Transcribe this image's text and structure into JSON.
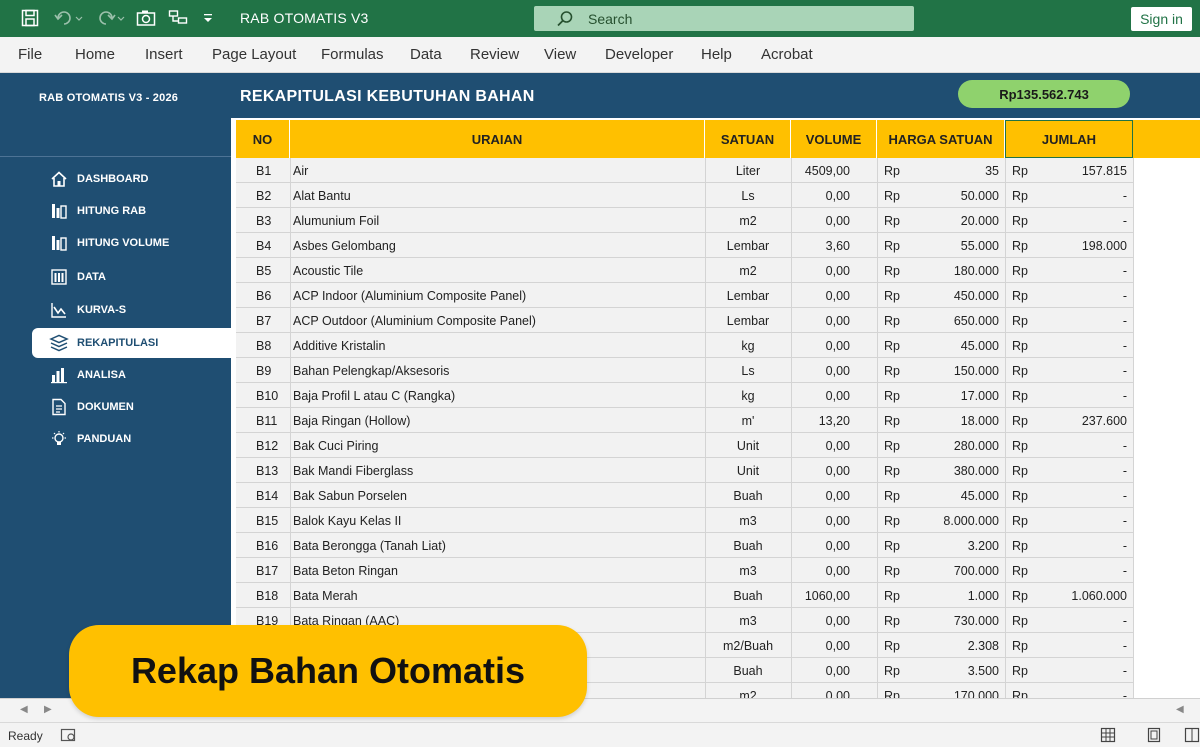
{
  "titlebar": {
    "app_title": "RAB OTOMATIS V3",
    "search_placeholder": "Search",
    "signin_label": "Sign in"
  },
  "ribbon": {
    "tabs": [
      "File",
      "Home",
      "Insert",
      "Page Layout",
      "Formulas",
      "Data",
      "Review",
      "View",
      "Developer",
      "Help",
      "Acrobat"
    ]
  },
  "sidebar": {
    "title": "RAB OTOMATIS V3 - 2026",
    "items": [
      {
        "label": "DASHBOARD",
        "icon": "home-icon",
        "active": false
      },
      {
        "label": "HITUNG RAB",
        "icon": "calculator-icon",
        "active": false
      },
      {
        "label": "HITUNG VOLUME",
        "icon": "calculator-icon",
        "active": false
      },
      {
        "label": "DATA",
        "icon": "database-icon",
        "active": false
      },
      {
        "label": "KURVA-S",
        "icon": "line-chart-icon",
        "active": false
      },
      {
        "label": "REKAPITULASI",
        "icon": "layers-icon",
        "active": true
      },
      {
        "label": "ANALISA",
        "icon": "bar-chart-icon",
        "active": false
      },
      {
        "label": "DOKUMEN",
        "icon": "document-icon",
        "active": false
      },
      {
        "label": "PANDUAN",
        "icon": "lightbulb-icon",
        "active": false
      }
    ]
  },
  "main": {
    "title": "REKAPITULASI KEBUTUHAN BAHAN",
    "total": "Rp135.562.743"
  },
  "table": {
    "columns": [
      "NO",
      "URAIAN",
      "SATUAN",
      "VOLUME",
      "HARGA SATUAN",
      "JUMLAH"
    ],
    "currency": "Rp",
    "rows": [
      {
        "no": "B1",
        "uraian": "Air",
        "satuan": "Liter",
        "volume": "4509,00",
        "harga": "35",
        "jumlah": "157.815"
      },
      {
        "no": "B2",
        "uraian": "Alat Bantu",
        "satuan": "Ls",
        "volume": "0,00",
        "harga": "50.000",
        "jumlah": "-"
      },
      {
        "no": "B3",
        "uraian": "Alumunium Foil",
        "satuan": "m2",
        "volume": "0,00",
        "harga": "20.000",
        "jumlah": "-"
      },
      {
        "no": "B4",
        "uraian": "Asbes Gelombang",
        "satuan": "Lembar",
        "volume": "3,60",
        "harga": "55.000",
        "jumlah": "198.000"
      },
      {
        "no": "B5",
        "uraian": "Acoustic Tile",
        "satuan": "m2",
        "volume": "0,00",
        "harga": "180.000",
        "jumlah": "-"
      },
      {
        "no": "B6",
        "uraian": "ACP Indoor (Aluminium Composite Panel)",
        "satuan": "Lembar",
        "volume": "0,00",
        "harga": "450.000",
        "jumlah": "-"
      },
      {
        "no": "B7",
        "uraian": "ACP Outdoor (Aluminium Composite Panel)",
        "satuan": "Lembar",
        "volume": "0,00",
        "harga": "650.000",
        "jumlah": "-"
      },
      {
        "no": "B8",
        "uraian": "Additive Kristalin",
        "satuan": "kg",
        "volume": "0,00",
        "harga": "45.000",
        "jumlah": "-"
      },
      {
        "no": "B9",
        "uraian": "Bahan Pelengkap/Aksesoris",
        "satuan": "Ls",
        "volume": "0,00",
        "harga": "150.000",
        "jumlah": "-"
      },
      {
        "no": "B10",
        "uraian": "Baja Profil L atau C (Rangka)",
        "satuan": "kg",
        "volume": "0,00",
        "harga": "17.000",
        "jumlah": "-"
      },
      {
        "no": "B11",
        "uraian": "Baja Ringan (Hollow)",
        "satuan": "m'",
        "volume": "13,20",
        "harga": "18.000",
        "jumlah": "237.600"
      },
      {
        "no": "B12",
        "uraian": "Bak Cuci Piring",
        "satuan": "Unit",
        "volume": "0,00",
        "harga": "280.000",
        "jumlah": "-"
      },
      {
        "no": "B13",
        "uraian": "Bak Mandi Fiberglass",
        "satuan": "Unit",
        "volume": "0,00",
        "harga": "380.000",
        "jumlah": "-"
      },
      {
        "no": "B14",
        "uraian": "Bak Sabun Porselen",
        "satuan": "Buah",
        "volume": "0,00",
        "harga": "45.000",
        "jumlah": "-"
      },
      {
        "no": "B15",
        "uraian": "Balok Kayu Kelas II",
        "satuan": "m3",
        "volume": "0,00",
        "harga": "8.000.000",
        "jumlah": "-"
      },
      {
        "no": "B16",
        "uraian": "Bata Berongga (Tanah Liat)",
        "satuan": "Buah",
        "volume": "0,00",
        "harga": "3.200",
        "jumlah": "-"
      },
      {
        "no": "B17",
        "uraian": "Bata Beton Ringan",
        "satuan": "m3",
        "volume": "0,00",
        "harga": "700.000",
        "jumlah": "-"
      },
      {
        "no": "B18",
        "uraian": "Bata Merah",
        "satuan": "Buah",
        "volume": "1060,00",
        "harga": "1.000",
        "jumlah": "1.060.000"
      },
      {
        "no": "B19",
        "uraian": "Bata Ringan (AAC)",
        "satuan": "m3",
        "volume": "0,00",
        "harga": "730.000",
        "jumlah": "-"
      },
      {
        "no": "",
        "uraian": "",
        "satuan": "m2/Buah",
        "volume": "0,00",
        "harga": "2.308",
        "jumlah": "-"
      },
      {
        "no": "",
        "uraian": "",
        "satuan": "Buah",
        "volume": "0,00",
        "harga": "3.500",
        "jumlah": "-"
      },
      {
        "no": "",
        "uraian": "",
        "satuan": "m2",
        "volume": "0,00",
        "harga": "170.000",
        "jumlah": "-"
      }
    ]
  },
  "banner": {
    "text": "Rekap Bahan Otomatis"
  },
  "statusbar": {
    "status": "Ready"
  },
  "colors": {
    "excel_green": "#217346",
    "navy": "#1f4e72",
    "header_yellow": "#ffc000",
    "badge_green": "#8fd26d"
  }
}
